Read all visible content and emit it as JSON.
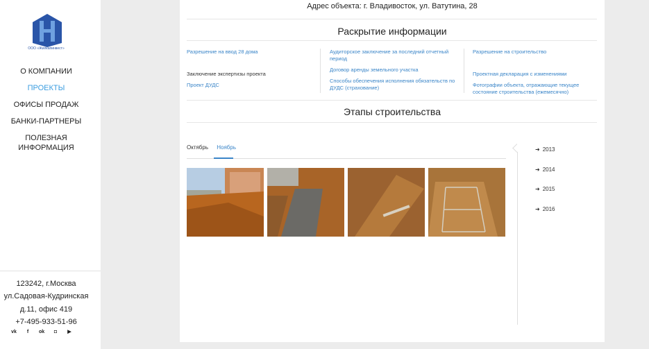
{
  "company": {
    "logo_caption": "ООО «Жилкапинвест»"
  },
  "nav": [
    {
      "label": "О КОМПАНИИ",
      "active": false
    },
    {
      "label": "ПРОЕКТЫ",
      "active": true
    },
    {
      "label": "ОФИСЫ ПРОДАЖ",
      "active": false
    },
    {
      "label": "БАНКИ-ПАРТНЕРЫ",
      "active": false
    },
    {
      "label": "ПОЛЕЗНАЯ ИНФОРМАЦИЯ",
      "active": false
    }
  ],
  "contact": {
    "line1": "123242, г.Москва",
    "line2": "ул.Садовая-Кудринская",
    "line3": "д.11, офис 419",
    "phone": "+7-495-933-51-96"
  },
  "socials": [
    {
      "icon": "vk-icon",
      "glyph": "vk"
    },
    {
      "icon": "facebook-icon",
      "glyph": "f"
    },
    {
      "icon": "odnoklassniki-icon",
      "glyph": "ok"
    },
    {
      "icon": "instagram-icon",
      "glyph": "◘"
    },
    {
      "icon": "youtube-icon",
      "glyph": "▶"
    }
  ],
  "address": "Адрес объекта: г. Владивосток, ул. Ватутина, 28",
  "disclosure": {
    "title": "Раскрытие информации",
    "col1": [
      {
        "label": "Разрешение на ввод 28 дома",
        "link": true
      },
      {
        "label": "Заключение экспертизы проекта",
        "link": false
      },
      {
        "label": "Проект ДУДС",
        "link": true
      }
    ],
    "col2": [
      {
        "label": "Аудиторское заключение за последний отчетный период",
        "link": true
      },
      {
        "label": "Договор аренды земельного участка",
        "link": true
      },
      {
        "label": "Способы обеспечения исполнения обязательств по ДУДС (страхование)",
        "link": true
      }
    ],
    "col3": [
      {
        "label": "Разрешение на строительство",
        "link": true
      },
      {
        "label": "Проектная декларация с изменениями",
        "link": true
      },
      {
        "label": "Фотографии объекта, отражающие текущее состояние строительства (ежемесячно)",
        "link": true
      }
    ]
  },
  "stages": {
    "title": "Этапы строительства",
    "months": [
      {
        "label": "Октябрь",
        "active": false
      },
      {
        "label": "Ноябрь",
        "active": true
      }
    ],
    "years": [
      "2013",
      "2014",
      "2015",
      "2016"
    ],
    "photos": [
      {
        "name": "construction-photo-1"
      },
      {
        "name": "construction-photo-2"
      },
      {
        "name": "construction-photo-3"
      },
      {
        "name": "construction-photo-4"
      }
    ]
  },
  "colors": {
    "accent": "#3b9de0",
    "link": "#3a85c8",
    "logo": "#2a55a8"
  }
}
